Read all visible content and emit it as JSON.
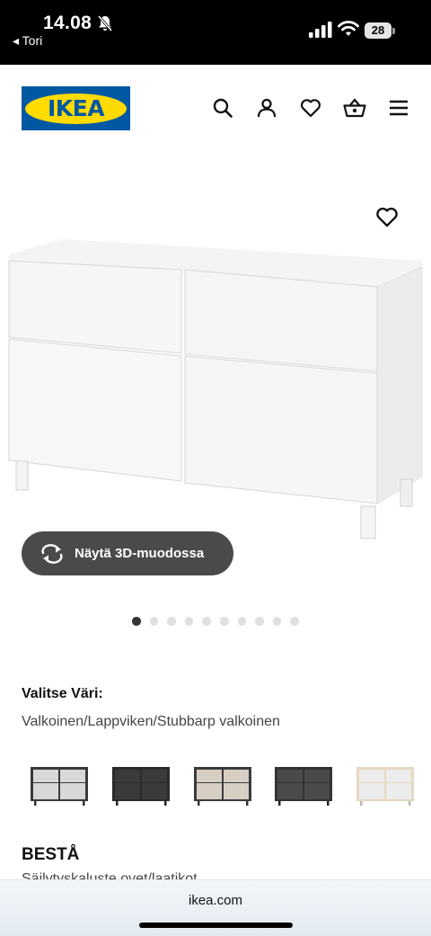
{
  "status_bar": {
    "time": "14.08",
    "back_app": "◂ Tori",
    "battery": "28"
  },
  "header": {
    "logo_text": "IKEA",
    "icons": [
      "search-icon",
      "user-icon",
      "heart-icon",
      "basket-icon",
      "menu-icon"
    ]
  },
  "product_image": {
    "favourite_icon": "heart-outline-icon"
  },
  "view_3d": {
    "label": "Näytä 3D-muodossa",
    "icon": "rotate-arrows-icon"
  },
  "carousel": {
    "count": 10,
    "active_index": 0
  },
  "color_section": {
    "title": "Valitse Väri:",
    "value": "Valkoinen/Lappviken/Stubbarp valkoinen",
    "swatches": [
      {
        "body": "#3a3a3a",
        "front": "#d8d8d8"
      },
      {
        "body": "#2a2a2a",
        "front": "#3a3a3a"
      },
      {
        "body": "#3a3a3a",
        "front": "#d8cfc4"
      },
      {
        "body": "#3a3a3a",
        "front": "#4a4a4a"
      },
      {
        "body": "#e6d8c0",
        "front": "#e8e8e8"
      }
    ]
  },
  "product": {
    "name": "BESTÅ",
    "description": "Säilytyskaluste ovet/laatikot"
  },
  "browser": {
    "url": "ikea.com"
  },
  "colors": {
    "ikea_blue": "#0058a3",
    "ikea_yellow": "#ffdb00",
    "button_dark": "#4a4a4a"
  }
}
